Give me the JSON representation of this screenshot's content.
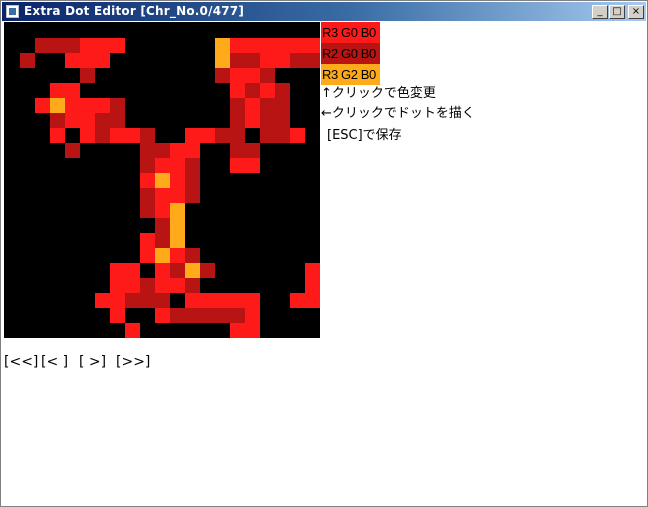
{
  "window": {
    "title": "Extra Dot Editor [Chr_No.0/477]",
    "controls": {
      "minimize": "_",
      "maximize": "□",
      "close": "×"
    }
  },
  "palette": [
    {
      "label": "R3 G0 B0",
      "color": "#ff1a1a"
    },
    {
      "label": "R2 G0 B0",
      "color": "#b81414"
    },
    {
      "label": "R3 G2 B0",
      "color": "#ffaa1a"
    }
  ],
  "help": {
    "change_color": "↑クリックで色変更",
    "draw_dot": "←クリックでドットを描く",
    "save": "[ESC]で保存"
  },
  "navigation": {
    "first": "[<<]",
    "prev": "[< ]",
    "next": "[ >]",
    "last": "[>>]"
  },
  "editor": {
    "grid_size": 21,
    "colors": {
      "0": "#000000",
      "1": "#ff1a1a",
      "2": "#b81414",
      "3": "#ffaa1a"
    },
    "pixels": [
      "000000000000000000000",
      "002221110000003111111",
      "020011100000003221122",
      "000002000000002112000",
      "000110000000000121200",
      "001311120000000212200",
      "000211220000000212200",
      "000101211200112202210",
      "000020000221100220000",
      "000000000211200110000",
      "000000000131200000000",
      "000000000211200000000",
      "000000000213000000000",
      "000000000023000000000",
      "000000000123000000000",
      "000000000131200000000",
      "000000011012320000001",
      "000000011211200000001",
      "000000112220111110011",
      "000000010012222210000",
      "000000001000000110000"
    ]
  }
}
